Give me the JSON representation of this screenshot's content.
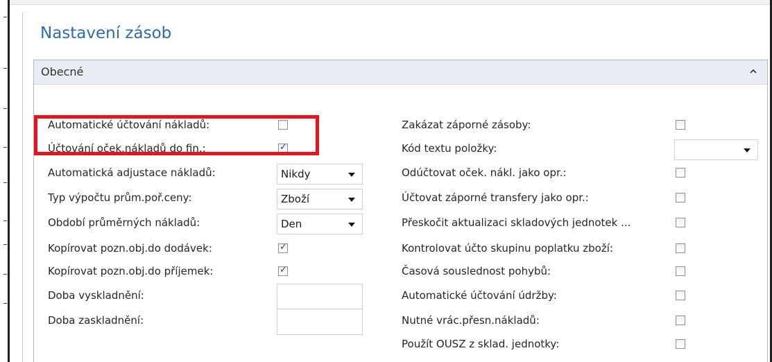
{
  "page": {
    "title": "Nastavení zásob"
  },
  "section": {
    "title": "Obecné",
    "collapse_icon": "chevron-up-icon"
  },
  "left_fields": [
    {
      "label": "Automatické účtování nákladů:",
      "type": "checkbox",
      "checked": false
    },
    {
      "label": "Účtování oček.nákladů do fin.:",
      "type": "checkbox",
      "checked": true
    },
    {
      "label": "Automatická adjustace nákladů:",
      "type": "select",
      "value": "Nikdy"
    },
    {
      "label": "Typ výpočtu prům.poř.ceny:",
      "type": "select",
      "value": "Zboží"
    },
    {
      "label": "Období průměrných nákladů:",
      "type": "select",
      "value": "Den"
    },
    {
      "label": "Kopírovat pozn.obj.do dodávek:",
      "type": "checkbox",
      "checked": true
    },
    {
      "label": "Kopírovat pozn.obj.do příjemek:",
      "type": "checkbox",
      "checked": true
    },
    {
      "label": "Doba vyskladnění:",
      "type": "text",
      "value": ""
    },
    {
      "label": "Doba zaskladnění:",
      "type": "text",
      "value": ""
    }
  ],
  "right_fields": [
    {
      "label": "Zakázat záporné zásoby:",
      "type": "checkbox",
      "checked": false
    },
    {
      "label": "Kód textu položky:",
      "type": "select",
      "value": ""
    },
    {
      "label": "Odúčtovat oček. nákl. jako opr.:",
      "type": "checkbox",
      "checked": false
    },
    {
      "label": "Účtovat záporné transfery jako opr.:",
      "type": "checkbox",
      "checked": false
    },
    {
      "label": "Přeskočit aktualizaci skladových jednotek ...",
      "type": "checkbox",
      "checked": false
    },
    {
      "label": "Kontrolovat účto skupinu poplatku zboží:",
      "type": "checkbox",
      "checked": false
    },
    {
      "label": "Časová souslednost pohybů:",
      "type": "checkbox",
      "checked": false
    },
    {
      "label": "Automatické účtování údržby:",
      "type": "checkbox",
      "checked": false
    },
    {
      "label": "Nutné vrác.přesn.nákladů:",
      "type": "checkbox",
      "checked": false
    },
    {
      "label": "Použít OUSZ z sklad. jednotky:",
      "type": "checkbox",
      "checked": false
    }
  ],
  "colors": {
    "title": "#2b6cb0",
    "highlight": "#e8131c",
    "check": "#2a3f8f"
  }
}
